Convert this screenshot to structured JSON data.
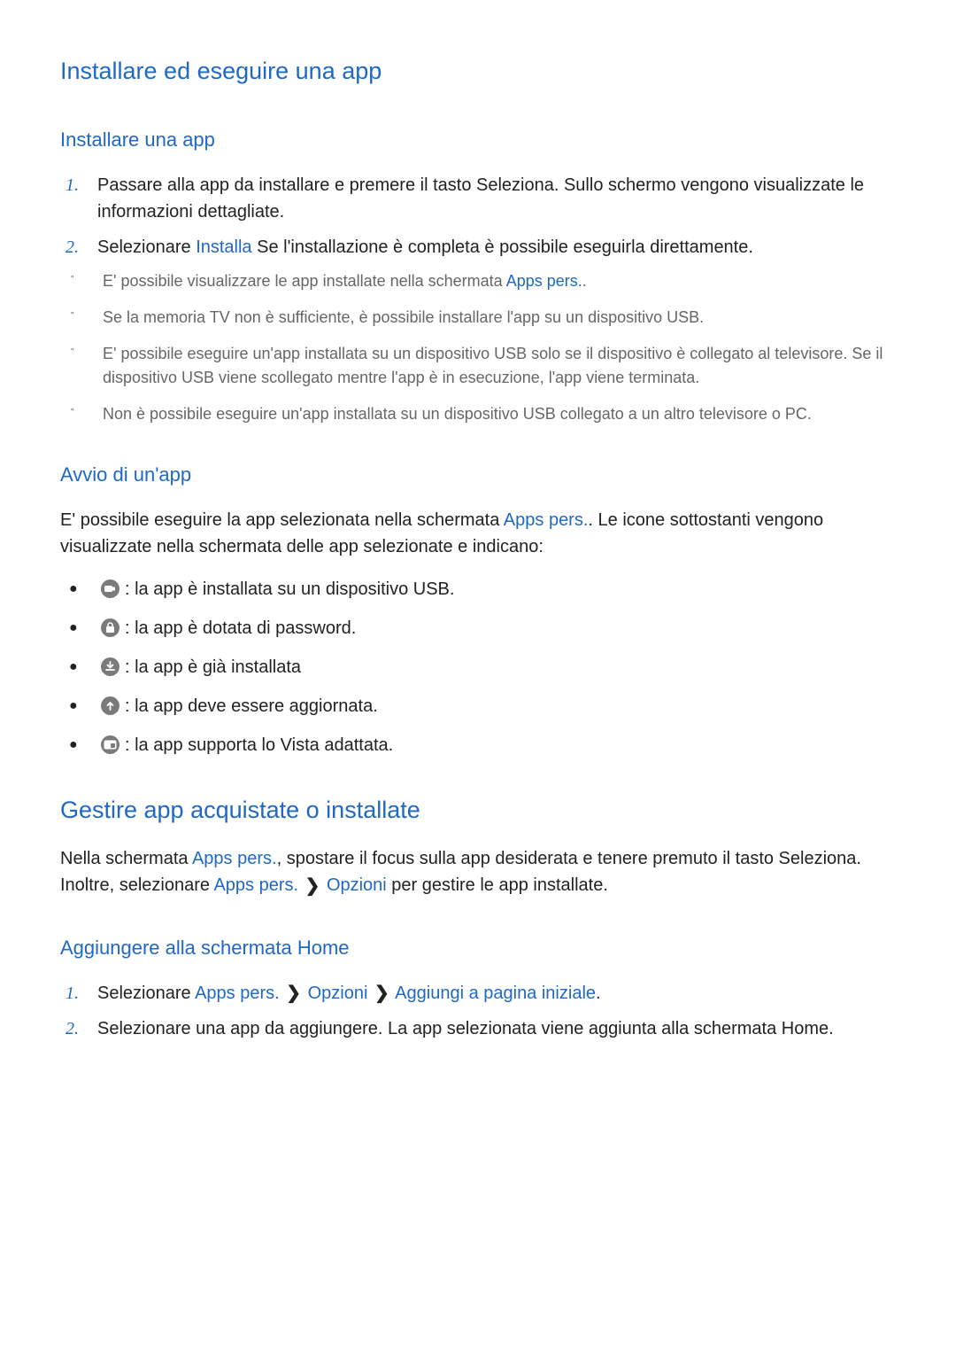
{
  "section1": {
    "title": "Installare ed eseguire una app",
    "sub1": {
      "title": "Installare una app",
      "steps": {
        "1": "Passare alla app da installare e premere il tasto Seleziona. Sullo schermo vengono visualizzate le informazioni dettagliate.",
        "2a": "Selezionare ",
        "2link": "Installa",
        "2b": " Se l'installazione è completa è possibile eseguirla direttamente."
      },
      "notes": {
        "0a": "E' possibile visualizzare le app installate nella schermata ",
        "0link": "Apps pers.",
        "0b": ".",
        "1": "Se la memoria TV non è sufficiente, è possibile installare l'app su un dispositivo USB.",
        "2": "E' possibile eseguire un'app installata su un dispositivo USB solo se il dispositivo è collegato al televisore. Se il dispositivo USB viene scollegato mentre l'app è in esecuzione, l'app viene terminata.",
        "3": "Non è possibile eseguire un'app installata su un dispositivo USB collegato a un altro televisore o PC."
      }
    },
    "sub2": {
      "title": "Avvio di un'app",
      "para_a": "E' possibile eseguire la app selezionata nella schermata ",
      "para_link": "Apps pers.",
      "para_b": ". Le icone sottostanti vengono visualizzate nella schermata delle app selezionate e indicano:",
      "bullets": {
        "0": " : la app è installata su un dispositivo USB.",
        "1": " : la app è dotata di password.",
        "2": " : la app è già installata",
        "3": " : la app deve essere aggiornata.",
        "4": ": la app supporta lo Vista adattata."
      }
    }
  },
  "section2": {
    "title": "Gestire app acquistate o installate",
    "para1_a": "Nella schermata ",
    "para1_link1": "Apps pers.",
    "para1_b": ", spostare il focus sulla app desiderata e tenere premuto il tasto Seleziona. Inoltre, selezionare ",
    "para1_link2": "Apps pers.",
    "para1_link3": "Opzioni",
    "para1_c": " per gestire le app installate.",
    "sub1": {
      "title": "Aggiungere alla schermata Home",
      "steps": {
        "1a": "Selezionare ",
        "1link1": "Apps pers.",
        "1link2": "Opzioni",
        "1link3": "Aggiungi a pagina iniziale",
        "1b": ".",
        "2": "Selezionare una app da aggiungere. La app selezionata viene aggiunta alla schermata Home."
      }
    }
  },
  "glyphs": {
    "chevron": "❯"
  }
}
